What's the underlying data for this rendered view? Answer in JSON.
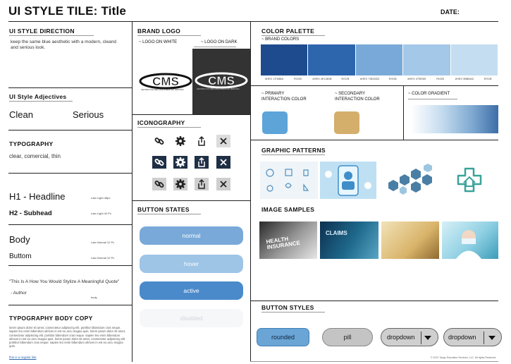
{
  "header": {
    "title": "UI STYLE TILE: Title",
    "date_label": "DATE:"
  },
  "direction": {
    "heading": "UI STYLE DIRECTION",
    "text": "keep the same blue aesthetic with a modern, cleand and serious look."
  },
  "adjectives": {
    "heading": "UI Style Adjectives",
    "items": [
      "Clean",
      "Serious"
    ]
  },
  "typography": {
    "heading": "TYPOGRAPHY",
    "subtitle": "clear, comercial, thin",
    "h1": "H1 - Headline",
    "h1_note": "Lato Light  48px",
    "h2": "H2 - Subhead",
    "h2_note": "Lato Light  42.Px",
    "body": "Body",
    "body_note": "Lato Normal 12 Px",
    "buttom": "Buttom",
    "buttom_note": "Lato Normal 12 Px",
    "quote": "\"This Is A How You Would Stylize A Meaningful Quote\"",
    "quote_author": "- Author",
    "quote_note": "body"
  },
  "body_copy": {
    "heading": "TYPOGRAPHY BODY COPY",
    "text": "lorem ipsum dolor sit amet, consectetur adipiscing elit. porttitor bibendum cras neque. sapien leo enim bibendum ultrices in est eu arcu magna quis. lorem ipsum dolor sit amet, consectetur adipiscing elit. porttitor bibendum cras neque. sapien leo enim bibendum ultrices in est eu arcu magna quis. lorem ipsum dolor sit amet, consectetur adipiscing elit. porttitor bibendum cras neque. sapien leo enim bibendum ultrices in est eu arcu magna quis.",
    "link": "this is a regular link"
  },
  "brand_logo": {
    "heading": "BRAND LOGO",
    "on_white": "~ LOGO ON WHITE",
    "on_dark": "~ LOGO ON DARK",
    "logo_text": "CMS",
    "logo_subtext": "CENTERS FOR MEDICARE & MEDICAID SERVICES"
  },
  "iconography": {
    "heading": "ICONOGRAPHY",
    "icons": [
      "link-icon",
      "gear-icon",
      "share-icon",
      "close-icon"
    ]
  },
  "button_states": {
    "heading": "BUTTON STATES",
    "normal": "normal",
    "hover": "hover",
    "active": "active",
    "disabled": "disabled"
  },
  "color_palette": {
    "heading": "COLOR PALETTE",
    "brand_colors_label": "~ BRAND COLORS",
    "brand_colors": [
      {
        "hex": "#1E4B8E",
        "code": "#HEX 1F4B8A",
        "rgb": "R/G/B"
      },
      {
        "hex": "#2E66AE",
        "code": "#HEX 4EC8DB",
        "rgb": "R/G/B"
      },
      {
        "hex": "#79A9D8",
        "code": "#HEX 75DDDD",
        "rgb": "R/G/B"
      },
      {
        "hex": "#A3C8E8",
        "code": "#HEX 475E5B",
        "rgb": "R/G/B"
      },
      {
        "hex": "#C4DDF1",
        "code": "#HEX 9B8BA5",
        "rgb": "R/G/B"
      }
    ],
    "primary_label": "~ PRIMARY\nINTERACTION COLOR",
    "primary_color": "#5DA4D9",
    "secondary_label": "~ SECONDARY\nINTERACTION COLOR",
    "secondary_color": "#D4AE6B",
    "gradient_label": "~ COLOR GRADIENT"
  },
  "graphic_patterns": {
    "heading": "GRAPHIC PATTERNS"
  },
  "image_samples": {
    "heading": "IMAGE SAMPLES",
    "claims_text": "CLAIMS",
    "health_text": "HEALTH\nINSURANCE"
  },
  "button_styles": {
    "heading": "BUTTON STYLES",
    "rounded": "rounded",
    "pill": "pill",
    "dropdown1": "dropdown",
    "dropdown2": "dropdown"
  },
  "footer": {
    "copyright": "© 2021 Tango Education Services, LLC. All rights Reserved."
  }
}
